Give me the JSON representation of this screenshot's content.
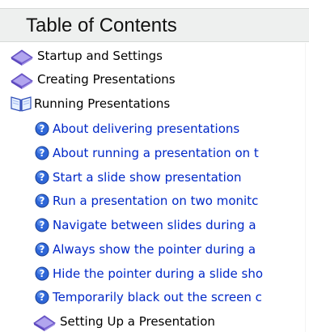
{
  "toc": {
    "title": "Table of Contents",
    "items": [
      {
        "label": "Startup and Settings",
        "type": "book",
        "icon": "closed-book-icon"
      },
      {
        "label": "Creating Presentations",
        "type": "book",
        "icon": "closed-book-icon"
      },
      {
        "label": "Running Presentations",
        "type": "book-open",
        "icon": "open-book-icon"
      },
      {
        "label": "About delivering presentations",
        "type": "topic",
        "icon": "help-icon"
      },
      {
        "label": "About running a presentation on t",
        "type": "topic",
        "icon": "help-icon"
      },
      {
        "label": "Start a slide show presentation",
        "type": "topic",
        "icon": "help-icon"
      },
      {
        "label": "Run a presentation on two monitc",
        "type": "topic",
        "icon": "help-icon"
      },
      {
        "label": "Navigate between slides during a",
        "type": "topic",
        "icon": "help-icon"
      },
      {
        "label": "Always show the pointer during a",
        "type": "topic",
        "icon": "help-icon"
      },
      {
        "label": "Hide the pointer during a slide sho",
        "type": "topic",
        "icon": "help-icon"
      },
      {
        "label": "Temporarily black out the screen c",
        "type": "topic",
        "icon": "help-icon"
      },
      {
        "label": "Setting Up a Presentation",
        "type": "book",
        "icon": "closed-book-icon"
      }
    ]
  },
  "colors": {
    "header_bg": "#eef0ef",
    "topic_link": "#0028c8",
    "folder_text": "#000000",
    "help_icon": "#2f67d8",
    "book_icon": "#8f78d8"
  }
}
